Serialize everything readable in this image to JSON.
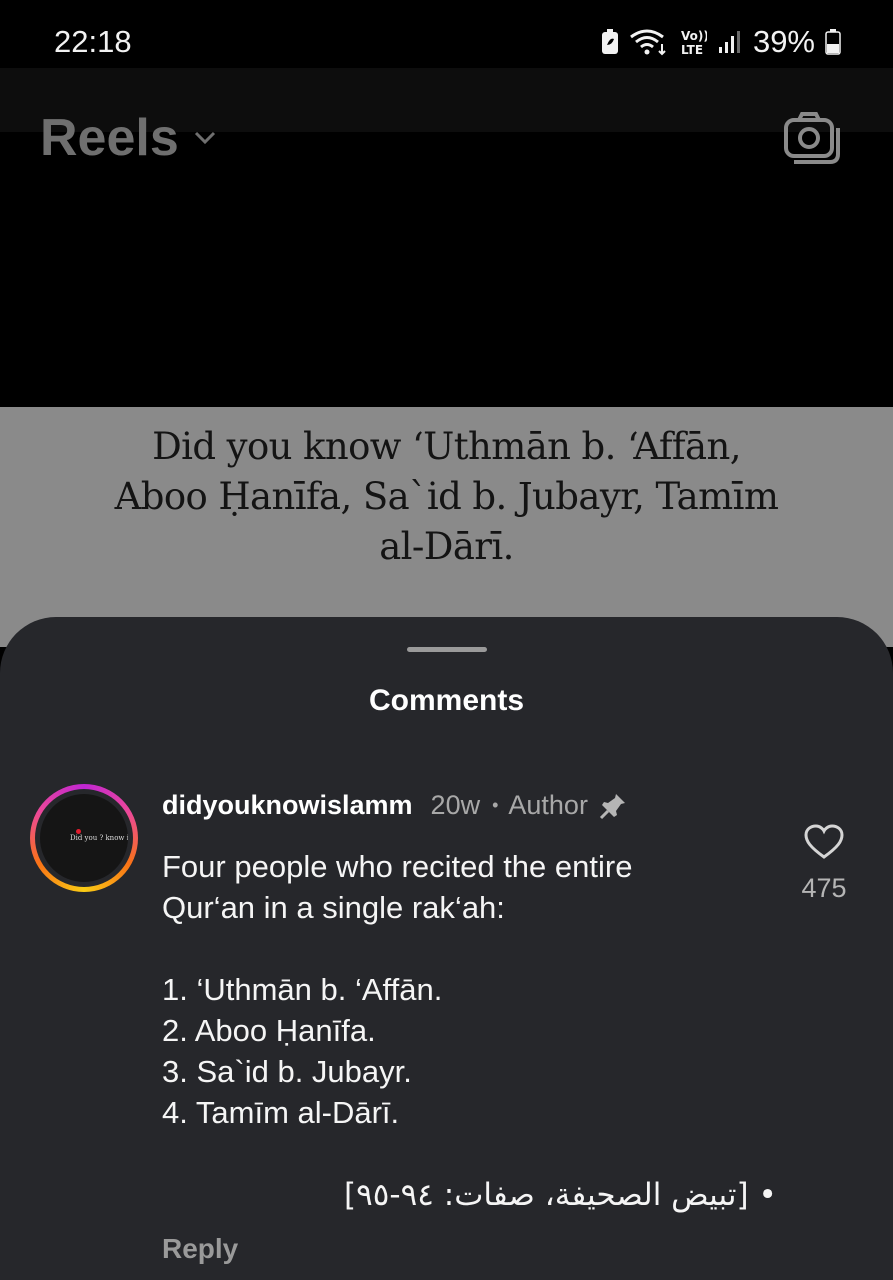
{
  "status_bar": {
    "time": "22:18",
    "battery_percent": "39%",
    "icons": [
      "battery-saver-icon",
      "wifi-icon",
      "volte-icon",
      "signal-icon",
      "battery-icon"
    ]
  },
  "header": {
    "title": "Reels",
    "title_icon": "chevron-down-icon",
    "camera_icon": "camera-icon"
  },
  "video": {
    "caption_lines": [
      "Did you know ‘Uthmān b. ‘Affān,",
      "Aboo Ḥanīfa, Sa`id b. Jubayr, Tamīm",
      "al-Dārī."
    ]
  },
  "comments_sheet": {
    "title": "Comments",
    "comment": {
      "avatar_logo_text": "Did you ? know islam",
      "username": "didyouknowislamm",
      "age": "20w",
      "separator": "•",
      "author_label": "Author",
      "pin_icon": "pin-icon",
      "body": "Four people who recited the entire\nQur‘an in a single rak‘ah:\n\n1. ‘Uthmān b. ‘Affān.\n2. Aboo Ḥanīfa.\n3. Sa`id b. Jubayr.\n4. Tamīm al-Dārī.",
      "source_line": "• [تبيض الصحيفة، صفات: ٩٤-٩٥]",
      "reply_label": "Reply",
      "like_icon": "heart-icon",
      "like_count": "475"
    }
  }
}
